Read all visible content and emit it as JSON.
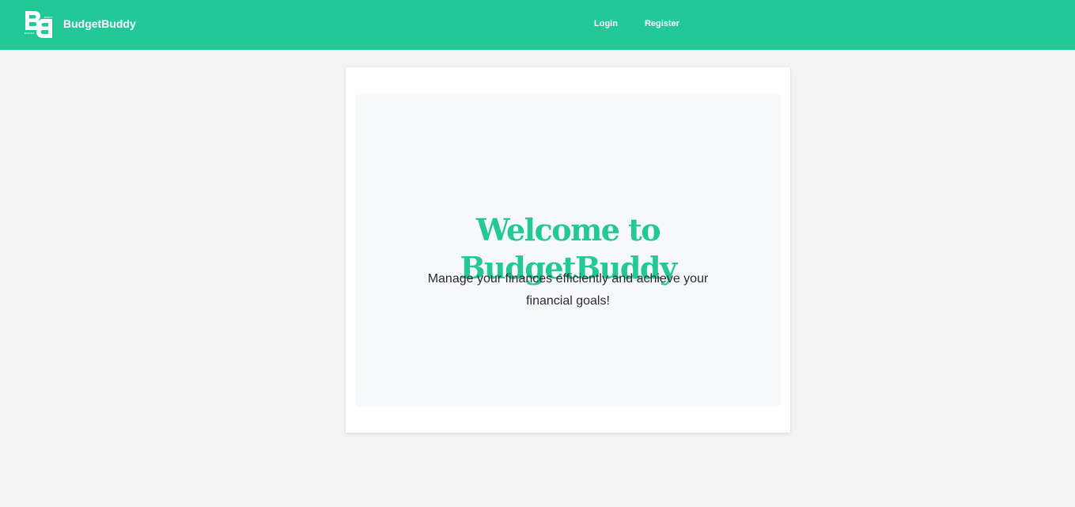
{
  "header": {
    "brand_name": "BudgetBuddy",
    "logo_icon": "budgetbuddy-bb-logo-icon",
    "logo_tiny_text_left": "BUDGET",
    "logo_tiny_text_right": "BUDDY",
    "nav": {
      "login_label": "Login",
      "register_label": "Register"
    }
  },
  "hero": {
    "title_line1": "Welcome to",
    "title_line2": "BudgetBuddy",
    "subtitle_line1": "Manage your finances efficiently and achieve your",
    "subtitle_line2": "financial goals!"
  },
  "colors": {
    "brand": "#22c997",
    "page_background": "#f3f3f3",
    "card_background": "#ffffff",
    "hero_background": "#f7f8fa",
    "body_text": "#2b2b2b"
  }
}
